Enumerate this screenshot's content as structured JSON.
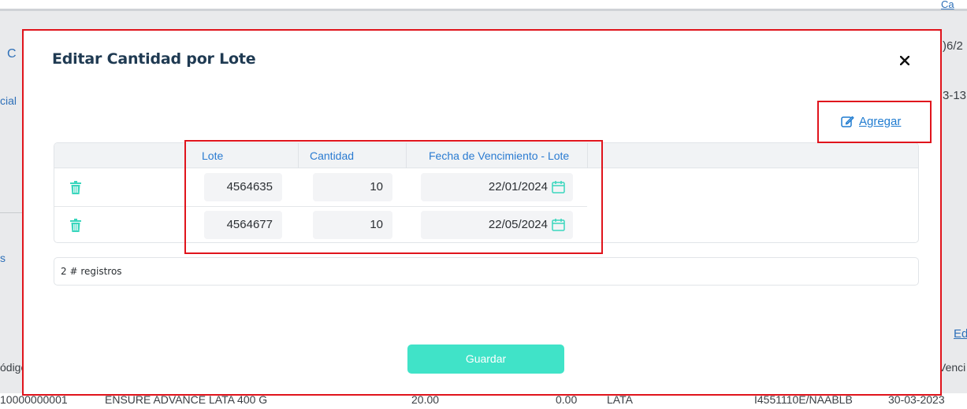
{
  "background": {
    "fragments": {
      "top_right_link": "Ca",
      "date_partial_1": ")6/2",
      "date_partial_2": "3-13",
      "left_c": "C",
      "left_cial": "cial",
      "left_s": "s",
      "right_ed": "Ed",
      "codigo_header": "ódigo",
      "venci_header": "Venci"
    },
    "bottom_row": {
      "code": "10000000001",
      "product": "ENSURE ADVANCE LATA 400 G",
      "qty": "20.00",
      "zero": "0.00",
      "unit": "LATA",
      "lot": "I4551110E/NAABLB",
      "date": "30-03-2023"
    }
  },
  "modal": {
    "title": "Editar Cantidad por Lote",
    "close_label": "×",
    "add_label": "Agregar",
    "columns": [
      "Lote",
      "Cantidad",
      "Fecha de Vencimiento - Lote"
    ],
    "rows": [
      {
        "lote": "4564635",
        "cantidad": "10",
        "fecha": "22/01/2024"
      },
      {
        "lote": "4564677",
        "cantidad": "10",
        "fecha": "22/05/2024"
      }
    ],
    "records_text": "2 # registros",
    "save_label": "Guardar"
  },
  "colors": {
    "accent": "#40e3c8",
    "title": "#1f3a52",
    "link": "#1f7bd0",
    "annotation": "#e0141c"
  }
}
